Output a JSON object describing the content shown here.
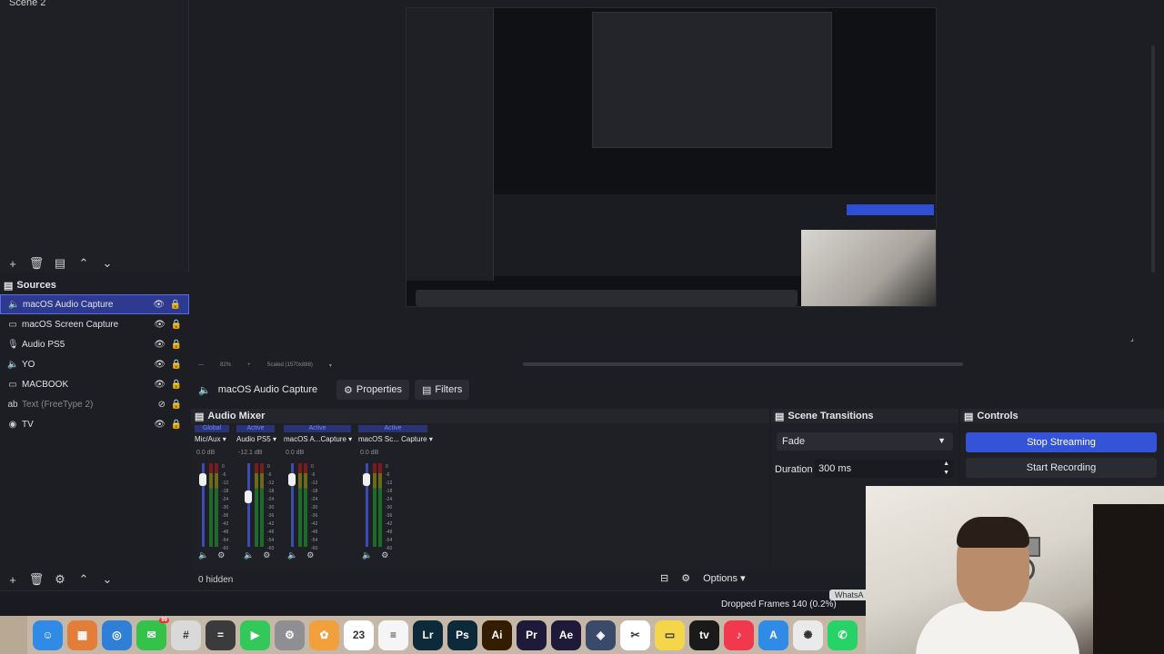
{
  "scenes": {
    "current": "Scene 2"
  },
  "sources": {
    "title": "Sources",
    "items": [
      {
        "label": "macOS Audio Capture",
        "icon": "speaker-icon",
        "selected": true
      },
      {
        "label": "macOS Screen Capture",
        "icon": "monitor-icon"
      },
      {
        "label": "Audio PS5",
        "icon": "microphone-icon"
      },
      {
        "label": "YO",
        "icon": "speaker-icon"
      },
      {
        "label": "MACBOOK",
        "icon": "monitor-icon"
      },
      {
        "label": "Text (FreeType 2)",
        "icon": "text-icon",
        "disabled": true
      },
      {
        "label": "TV",
        "icon": "camera-icon"
      }
    ]
  },
  "preview": {
    "zoom": "82%",
    "scale": "Scaled (1570x888)"
  },
  "context": {
    "source": "macOS Audio Capture",
    "properties": "Properties",
    "filters": "Filters"
  },
  "mixer": {
    "title": "Audio Mixer",
    "channels": [
      {
        "status": "Global",
        "name": "Mic/Aux",
        "db": "0.0 dB",
        "level": 0.86
      },
      {
        "status": "Active",
        "name": "Audio PS5",
        "db": "-12.1 dB",
        "level": 0.62
      },
      {
        "status": "Active",
        "name": "macOS A...Capture",
        "db": "0.0 dB",
        "level": 0.86
      },
      {
        "status": "Active",
        "name": "macOS Sc... Capture",
        "db": "0.0 dB",
        "level": 0.86
      }
    ],
    "scale": [
      "0",
      "-6",
      "-12",
      "-18",
      "-24",
      "-30",
      "-36",
      "-42",
      "-48",
      "-54",
      "-60"
    ],
    "hidden": "0 hidden",
    "options": "Options"
  },
  "transitions": {
    "title": "Scene Transitions",
    "selected": "Fade",
    "duration_label": "Duration",
    "duration_value": "300 ms"
  },
  "controls": {
    "title": "Controls",
    "stream": "Stop Streaming",
    "record": "Start Recording"
  },
  "status": {
    "dropped": "Dropped Frames 140 (0.2%)",
    "tooltip": "WhatsA"
  },
  "dock": {
    "apps": [
      {
        "name": "Finder",
        "color": "#2f8be6",
        "glyph": "☺"
      },
      {
        "name": "Launchpad",
        "color": "#e27d3a",
        "glyph": "▦"
      },
      {
        "name": "Safari",
        "color": "#2f7fd6",
        "glyph": "◎"
      },
      {
        "name": "Messages",
        "color": "#35c24a",
        "glyph": "✉",
        "badge": "99"
      },
      {
        "name": "Slack",
        "color": "#d9d9d9",
        "glyph": "#"
      },
      {
        "name": "Calculator",
        "color": "#3b3b3b",
        "glyph": "="
      },
      {
        "name": "FaceTime",
        "color": "#34c759",
        "glyph": "▶"
      },
      {
        "name": "System Settings",
        "color": "#8e8e93",
        "glyph": "⚙"
      },
      {
        "name": "Photos",
        "color": "#f2a03c",
        "glyph": "✿"
      },
      {
        "name": "Calendar",
        "color": "#ffffff",
        "glyph": "23"
      },
      {
        "name": "Reminders",
        "color": "#f5f5f5",
        "glyph": "≡"
      },
      {
        "name": "Lightroom",
        "color": "#0c2a3a",
        "glyph": "Lr"
      },
      {
        "name": "Photoshop",
        "color": "#0c2a3a",
        "glyph": "Ps"
      },
      {
        "name": "Illustrator",
        "color": "#331c00",
        "glyph": "Ai"
      },
      {
        "name": "Premiere Pro",
        "color": "#1f1a3a",
        "glyph": "Pr"
      },
      {
        "name": "After Effects",
        "color": "#1f1a3a",
        "glyph": "Ae"
      },
      {
        "name": "DaVinci Resolve",
        "color": "#3a4a6a",
        "glyph": "◈"
      },
      {
        "name": "CapCut",
        "color": "#ffffff",
        "glyph": "✂"
      },
      {
        "name": "Notes",
        "color": "#f5d54a",
        "glyph": "▭"
      },
      {
        "name": "Apple TV",
        "color": "#1a1a1a",
        "glyph": "tv"
      },
      {
        "name": "Music",
        "color": "#f2384c",
        "glyph": "♪"
      },
      {
        "name": "App Store",
        "color": "#2f8be6",
        "glyph": "A"
      },
      {
        "name": "ChatGPT",
        "color": "#eaeaea",
        "glyph": "✺"
      },
      {
        "name": "WhatsApp",
        "color": "#25d366",
        "glyph": "✆"
      }
    ]
  }
}
